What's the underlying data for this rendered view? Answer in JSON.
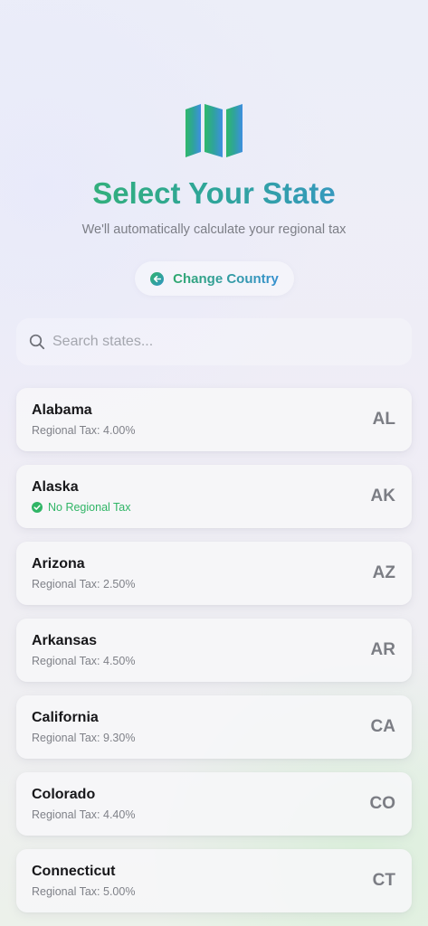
{
  "header": {
    "title": "Select Your State",
    "subtitle": "We'll automatically calculate your regional tax",
    "logo_icon": "map-icon"
  },
  "change_country": {
    "label": "Change Country",
    "icon": "arrow-left-circle-icon"
  },
  "search": {
    "placeholder": "Search states...",
    "value": "",
    "icon": "search-icon"
  },
  "states": [
    {
      "name": "Alabama",
      "tax": "Regional Tax: 4.00%",
      "abbr": "AL",
      "no_tax": false
    },
    {
      "name": "Alaska",
      "tax": "No Regional Tax",
      "abbr": "AK",
      "no_tax": true
    },
    {
      "name": "Arizona",
      "tax": "Regional Tax: 2.50%",
      "abbr": "AZ",
      "no_tax": false
    },
    {
      "name": "Arkansas",
      "tax": "Regional Tax: 4.50%",
      "abbr": "AR",
      "no_tax": false
    },
    {
      "name": "California",
      "tax": "Regional Tax: 9.30%",
      "abbr": "CA",
      "no_tax": false
    },
    {
      "name": "Colorado",
      "tax": "Regional Tax: 4.40%",
      "abbr": "CO",
      "no_tax": false
    },
    {
      "name": "Connecticut",
      "tax": "Regional Tax: 5.00%",
      "abbr": "CT",
      "no_tax": false
    }
  ],
  "colors": {
    "green": "#34b765",
    "teal": "#2fa59a",
    "blue": "#3b8fd8",
    "no_tax_green": "#30b566"
  }
}
